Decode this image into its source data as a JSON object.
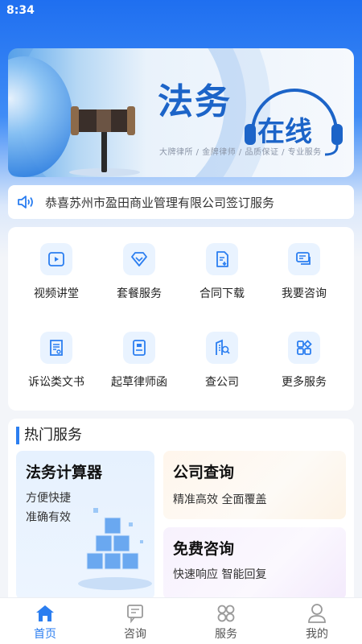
{
  "status_bar": {
    "time": "8:34"
  },
  "banner": {
    "title_main": "法务",
    "title_sub": "在线",
    "tagline": "大牌律所 / 金牌律师 / 品质保证 / 专业服务"
  },
  "notice": {
    "icon": "speaker-icon",
    "text": "恭喜苏州市盈田商业管理有限公司签订服务"
  },
  "services": [
    {
      "label": "视频讲堂",
      "icon": "video-icon"
    },
    {
      "label": "套餐服务",
      "icon": "diamond-icon"
    },
    {
      "label": "合同下载",
      "icon": "contract-download-icon"
    },
    {
      "label": "我要咨询",
      "icon": "chat-icon"
    },
    {
      "label": "诉讼类文书",
      "icon": "document-icon"
    },
    {
      "label": "起草律师函",
      "icon": "letter-icon"
    },
    {
      "label": "查公司",
      "icon": "building-search-icon"
    },
    {
      "label": "更多服务",
      "icon": "more-grid-icon"
    }
  ],
  "hot": {
    "title": "热门服务",
    "calc": {
      "title": "法务计算器",
      "line1": "方便快捷",
      "line2": "准确有效"
    },
    "company": {
      "title": "公司查询",
      "desc": "精准高效 全面覆盖"
    },
    "consult": {
      "title": "免费咨询",
      "desc": "快速响应 智能回复"
    }
  },
  "nav": [
    {
      "label": "首页",
      "icon": "home-icon",
      "active": true
    },
    {
      "label": "咨询",
      "icon": "consult-icon",
      "active": false
    },
    {
      "label": "服务",
      "icon": "service-icon",
      "active": false
    },
    {
      "label": "我的",
      "icon": "profile-icon",
      "active": false
    }
  ],
  "colors": {
    "primary": "#2b7ef0",
    "banner_title": "#1c64c8"
  }
}
